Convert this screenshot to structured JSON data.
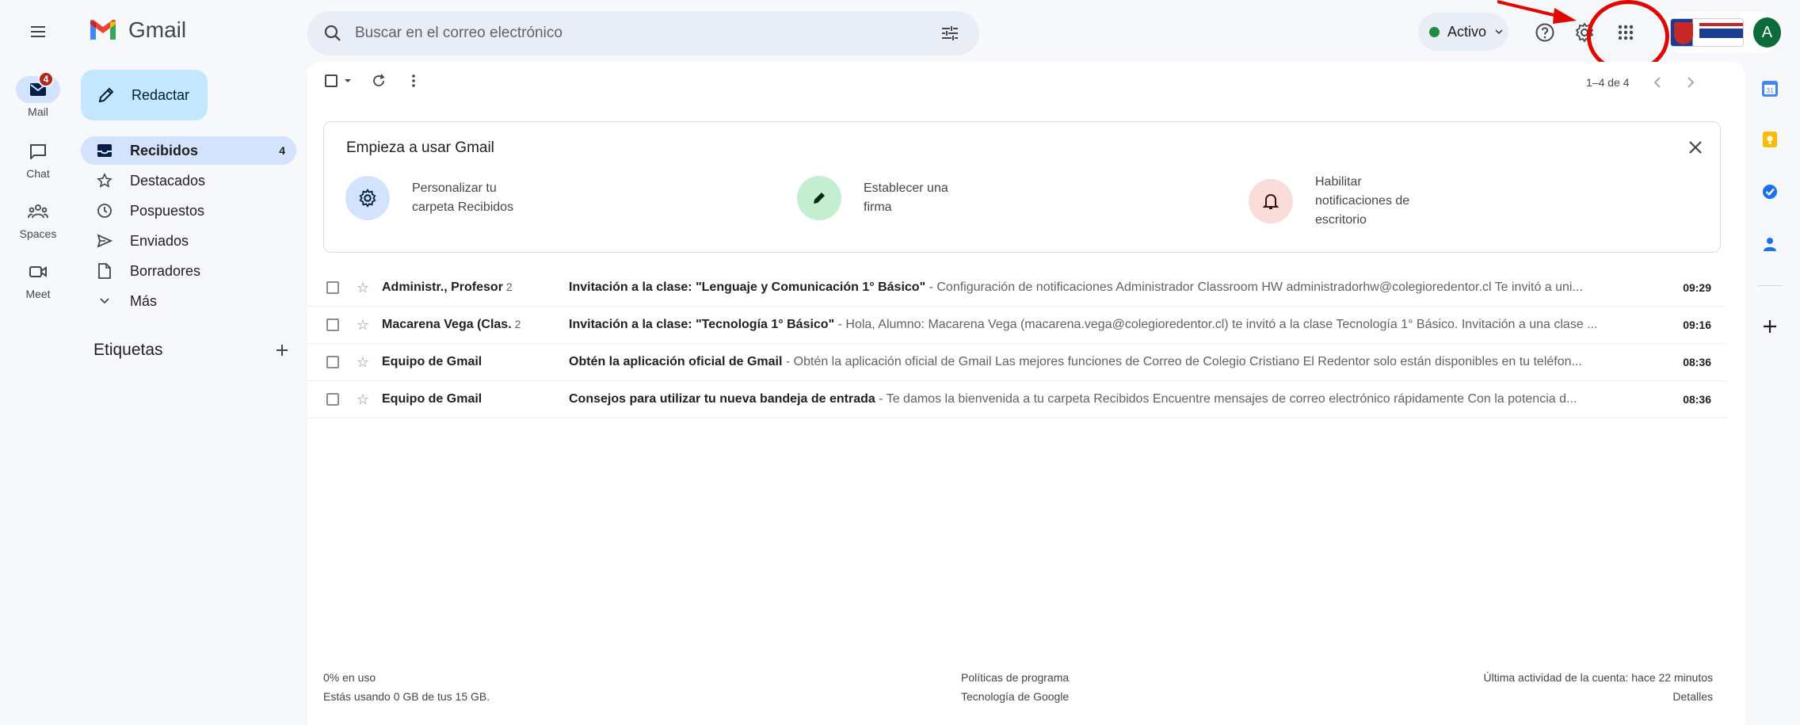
{
  "app": {
    "name": "Gmail"
  },
  "search": {
    "placeholder": "Buscar en el correo electrónico"
  },
  "header": {
    "status_label": "Activo",
    "avatar_letter": "A"
  },
  "rail": {
    "mail_badge": "4",
    "items": [
      {
        "label": "Mail"
      },
      {
        "label": "Chat"
      },
      {
        "label": "Spaces"
      },
      {
        "label": "Meet"
      }
    ]
  },
  "nav": {
    "compose_label": "Redactar",
    "items": [
      {
        "label": "Recibidos",
        "count": "4"
      },
      {
        "label": "Destacados"
      },
      {
        "label": "Pospuestos"
      },
      {
        "label": "Enviados"
      },
      {
        "label": "Borradores"
      },
      {
        "label": "Más"
      }
    ],
    "labels_title": "Etiquetas"
  },
  "toolbar": {
    "pager_text": "1–4 de 4"
  },
  "getting_started": {
    "title": "Empieza a usar Gmail",
    "items": [
      {
        "line1": "Personalizar tu",
        "line2": "carpeta Recibidos"
      },
      {
        "line1": "Establecer una",
        "line2": "firma"
      },
      {
        "line1": "Habilitar",
        "line2": "notificaciones de",
        "line3": "escritorio"
      }
    ]
  },
  "emails": [
    {
      "sender": "Administr., Profesor",
      "count": "2",
      "subject": "Invitación a la clase: \"Lenguaje y Comunicación 1° Básico\"",
      "snippet": " - Configuración de notificaciones Administrador Classroom HW administradorhw@colegioredentor.cl Te invitó a uni...",
      "time": "09:29"
    },
    {
      "sender": "Macarena Vega (Clas.",
      "count": "2",
      "subject": "Invitación a la clase: \"Tecnología 1° Básico\"",
      "snippet": " - Hola, Alumno: Macarena Vega (macarena.vega@colegioredentor.cl) te invitó a la clase Tecnología 1° Básico. Invitación a una clase ...",
      "time": "09:16"
    },
    {
      "sender": "Equipo de Gmail",
      "count": "",
      "subject": "Obtén la aplicación oficial de Gmail",
      "snippet": " - Obtén la aplicación oficial de Gmail Las mejores funciones de Correo de Colegio Cristiano El Redentor solo están disponibles en tu teléfon...",
      "time": "08:36"
    },
    {
      "sender": "Equipo de Gmail",
      "count": "",
      "subject": "Consejos para utilizar tu nueva bandeja de entrada",
      "snippet": " - Te damos la bienvenida a tu carpeta Recibidos Encuentre mensajes de correo electrónico rápidamente Con la potencia d...",
      "time": "08:36"
    }
  ],
  "footer": {
    "usage": "0% en uso",
    "storage": "Estás usando 0 GB de tus 15 GB.",
    "policies": "Políticas de programa",
    "powered": "Tecnología de Google",
    "last_activity": "Última actividad de la cuenta: hace 22 minutos",
    "details": "Detalles"
  },
  "colors": {
    "accent": "#d3e3fd",
    "compose": "#c2e7ff",
    "status_green": "#1e8e3e",
    "annotation_red": "#e10600"
  }
}
